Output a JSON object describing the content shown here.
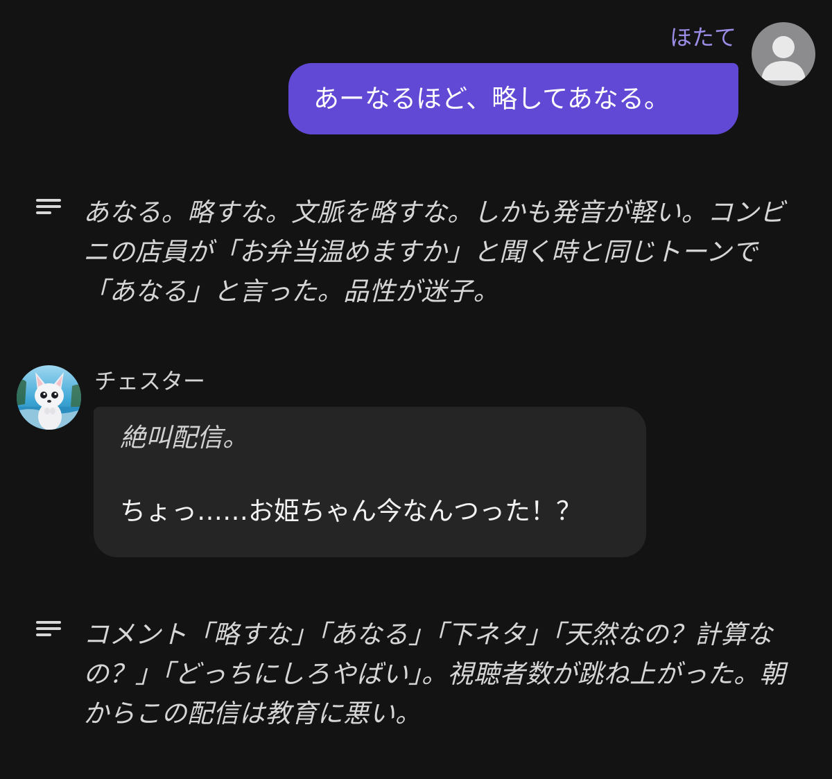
{
  "user_message": {
    "sender": "ほたて",
    "text": "あーなるほど、略してあなる。"
  },
  "narration_1": {
    "text": "あなる。略すな。文脈を略すな。しかも発音が軽い。コンビニの店員が「お弁当温めますか」と聞く時と同じトーンで「あなる」と言った。品性が迷子。"
  },
  "bot_message": {
    "sender": "チェスター",
    "action": "絶叫配信。",
    "dialogue": "ちょっ……お姫ちゃん今なんつった！？"
  },
  "narration_2": {
    "text": "コメント「略すな」「あなる」「下ネタ」「天然なの？計算なの？」「どっちにしろやばい」。視聴者数が跳ね上がった。朝からこの配信は教育に悪い。"
  },
  "icons": {
    "user_avatar": "person-silhouette-icon",
    "bot_avatar": "white-dog-character-avatar",
    "narration": "narration-lines-icon"
  },
  "colors": {
    "background": "#131314",
    "user_bubble": "#6149d6",
    "user_name": "#9c8ee8",
    "bot_bubble": "#252526",
    "avatar_gray": "#8c8c8e"
  }
}
